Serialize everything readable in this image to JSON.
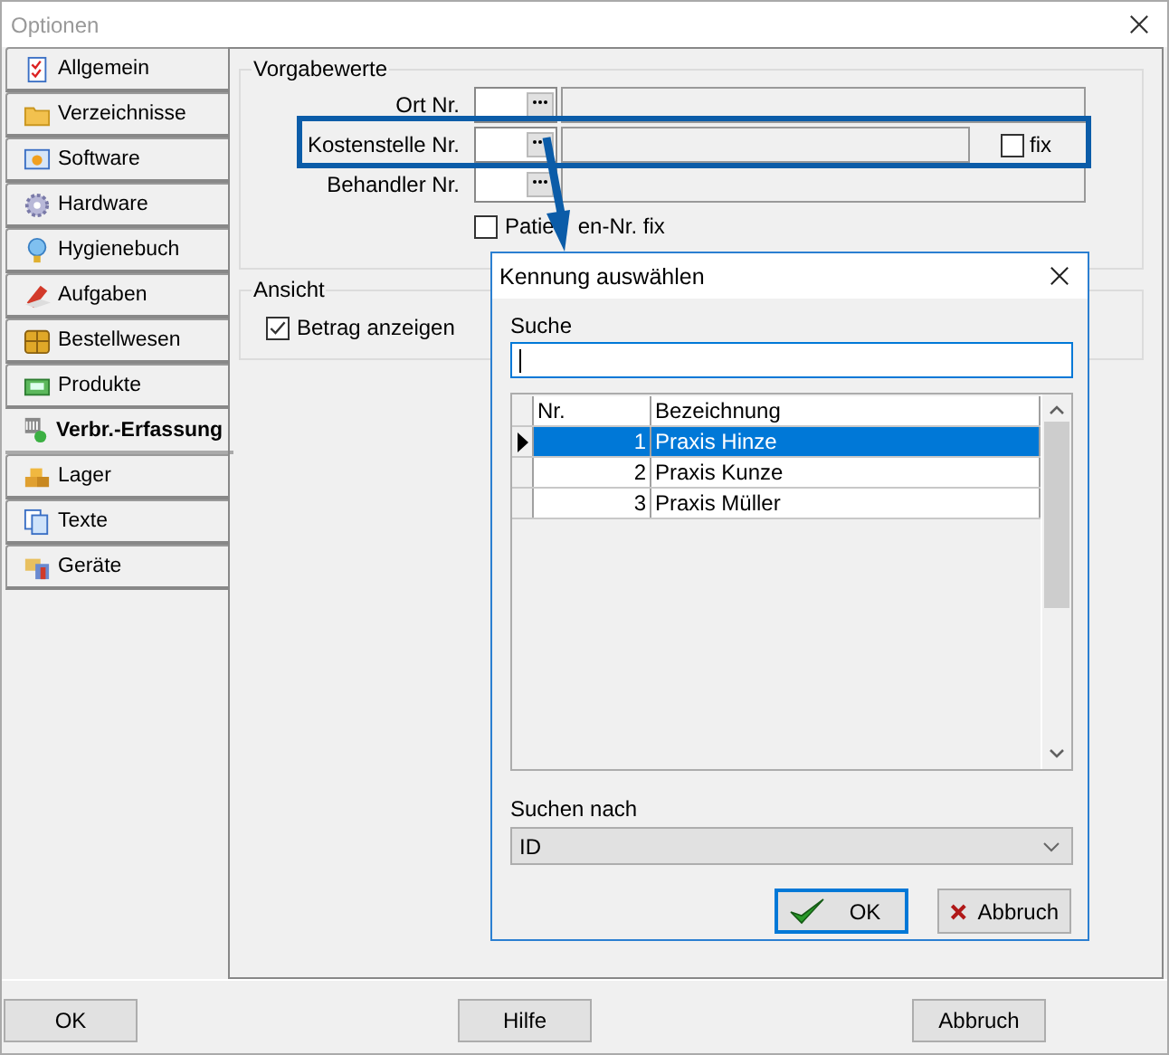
{
  "window": {
    "title": "Optionen"
  },
  "tabs": [
    {
      "label": "Allgemein",
      "selected": false
    },
    {
      "label": "Verzeichnisse",
      "selected": false
    },
    {
      "label": "Software",
      "selected": false
    },
    {
      "label": "Hardware",
      "selected": false
    },
    {
      "label": "Hygienebuch",
      "selected": false
    },
    {
      "label": "Aufgaben",
      "selected": false
    },
    {
      "label": "Bestellwesen",
      "selected": false
    },
    {
      "label": "Produkte",
      "selected": false
    },
    {
      "label": "Verbr.-Erfassung",
      "selected": true
    },
    {
      "label": "Lager",
      "selected": false
    },
    {
      "label": "Texte",
      "selected": false
    },
    {
      "label": "Geräte",
      "selected": false
    }
  ],
  "defaults": {
    "title": "Vorgabewerte",
    "fields": [
      {
        "label": "Ort Nr.",
        "kind": "plain"
      },
      {
        "label": "Kostenstelle Nr.",
        "kind": "with_fix",
        "fix": {
          "label": "fix",
          "checked": false
        }
      },
      {
        "label": "Behandler Nr.",
        "kind": "plain"
      }
    ],
    "checkbox": {
      "label_parts": [
        "Patie",
        "en-Nr. fix"
      ],
      "checked": false
    }
  },
  "view": {
    "title": "Ansicht",
    "checkbox": {
      "label": "Betrag anzeigen",
      "checked": true
    }
  },
  "dialog": {
    "title": "Kennung auswählen",
    "search_label": "Suche",
    "table": {
      "columns": [
        "Nr.",
        "Bezeichnung"
      ],
      "rows": [
        {
          "nr": "1",
          "name": "Praxis Hinze",
          "selected": true
        },
        {
          "nr": "2",
          "name": "Praxis Kunze",
          "selected": false
        },
        {
          "nr": "3",
          "name": "Praxis Müller",
          "selected": false
        }
      ]
    },
    "search_by_label": "Suchen nach",
    "search_by_value": "ID",
    "buttons": [
      {
        "label": "OK",
        "kind": "ok",
        "focused": true
      },
      {
        "label": "Abbruch",
        "kind": "cancel",
        "focused": false
      }
    ]
  },
  "buttons": [
    "OK",
    "Hilfe",
    "Abbruch"
  ]
}
